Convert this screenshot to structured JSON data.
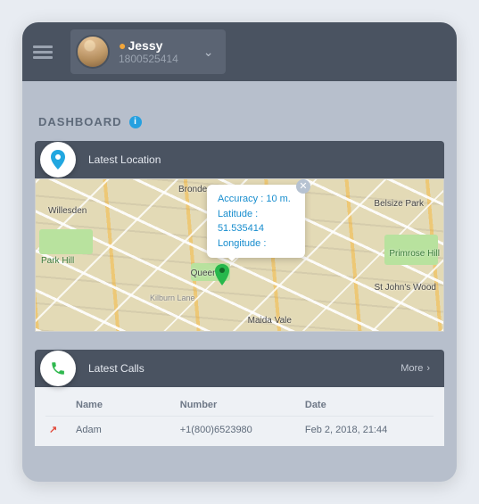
{
  "header": {
    "profile_name": "Jessy",
    "profile_id": "1800525414"
  },
  "page": {
    "title": "DASHBOARD"
  },
  "location_card": {
    "title": "Latest Location",
    "labels": {
      "willesden": "Willesden",
      "brondesbury": "Brondesbury",
      "belsize": "Belsize Park",
      "parkhill": "Park Hill",
      "queens": "Queen's",
      "stjohns": "St John's Wood",
      "maida": "Maida Vale",
      "primrose": "Primrose Hill",
      "kilburn": "Kilburn Lane"
    },
    "tooltip": {
      "accuracy": "Accuracy : 10 m.",
      "lat_label": "Latitude :",
      "lat_val": "51.535414",
      "lon_label": "Longitude :"
    }
  },
  "calls_card": {
    "title": "Latest Calls",
    "more": "More",
    "columns": {
      "name": "Name",
      "number": "Number",
      "date": "Date"
    },
    "rows": [
      {
        "name": "Adam",
        "number": "+1(800)6523980",
        "date": "Feb 2, 2018, 21:44"
      }
    ]
  }
}
